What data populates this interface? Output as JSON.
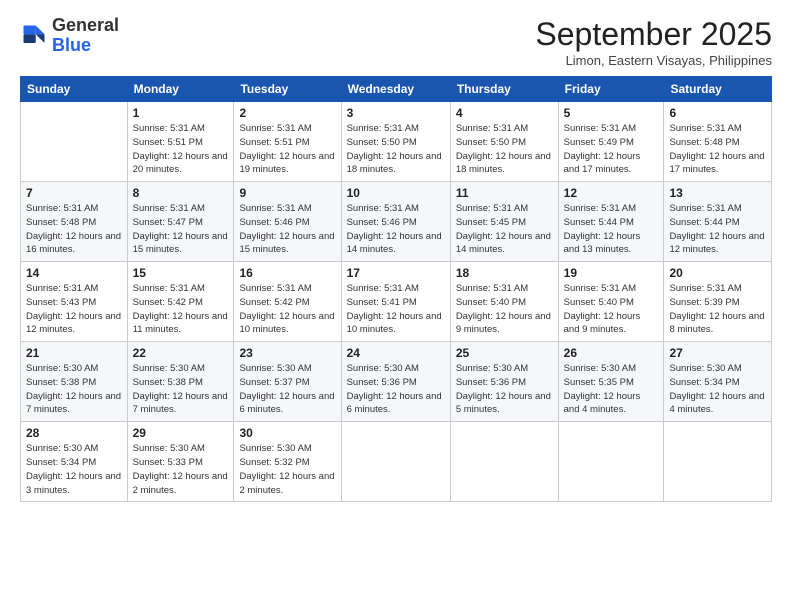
{
  "header": {
    "logo_general": "General",
    "logo_blue": "Blue",
    "cal_title": "September 2025",
    "cal_subtitle": "Limon, Eastern Visayas, Philippines"
  },
  "weekdays": [
    "Sunday",
    "Monday",
    "Tuesday",
    "Wednesday",
    "Thursday",
    "Friday",
    "Saturday"
  ],
  "weeks": [
    [
      {
        "day": "",
        "info": ""
      },
      {
        "day": "1",
        "info": "Sunrise: 5:31 AM\nSunset: 5:51 PM\nDaylight: 12 hours\nand 20 minutes."
      },
      {
        "day": "2",
        "info": "Sunrise: 5:31 AM\nSunset: 5:51 PM\nDaylight: 12 hours\nand 19 minutes."
      },
      {
        "day": "3",
        "info": "Sunrise: 5:31 AM\nSunset: 5:50 PM\nDaylight: 12 hours\nand 18 minutes."
      },
      {
        "day": "4",
        "info": "Sunrise: 5:31 AM\nSunset: 5:50 PM\nDaylight: 12 hours\nand 18 minutes."
      },
      {
        "day": "5",
        "info": "Sunrise: 5:31 AM\nSunset: 5:49 PM\nDaylight: 12 hours\nand 17 minutes."
      },
      {
        "day": "6",
        "info": "Sunrise: 5:31 AM\nSunset: 5:48 PM\nDaylight: 12 hours\nand 17 minutes."
      }
    ],
    [
      {
        "day": "7",
        "info": "Sunrise: 5:31 AM\nSunset: 5:48 PM\nDaylight: 12 hours\nand 16 minutes."
      },
      {
        "day": "8",
        "info": "Sunrise: 5:31 AM\nSunset: 5:47 PM\nDaylight: 12 hours\nand 15 minutes."
      },
      {
        "day": "9",
        "info": "Sunrise: 5:31 AM\nSunset: 5:46 PM\nDaylight: 12 hours\nand 15 minutes."
      },
      {
        "day": "10",
        "info": "Sunrise: 5:31 AM\nSunset: 5:46 PM\nDaylight: 12 hours\nand 14 minutes."
      },
      {
        "day": "11",
        "info": "Sunrise: 5:31 AM\nSunset: 5:45 PM\nDaylight: 12 hours\nand 14 minutes."
      },
      {
        "day": "12",
        "info": "Sunrise: 5:31 AM\nSunset: 5:44 PM\nDaylight: 12 hours\nand 13 minutes."
      },
      {
        "day": "13",
        "info": "Sunrise: 5:31 AM\nSunset: 5:44 PM\nDaylight: 12 hours\nand 12 minutes."
      }
    ],
    [
      {
        "day": "14",
        "info": "Sunrise: 5:31 AM\nSunset: 5:43 PM\nDaylight: 12 hours\nand 12 minutes."
      },
      {
        "day": "15",
        "info": "Sunrise: 5:31 AM\nSunset: 5:42 PM\nDaylight: 12 hours\nand 11 minutes."
      },
      {
        "day": "16",
        "info": "Sunrise: 5:31 AM\nSunset: 5:42 PM\nDaylight: 12 hours\nand 10 minutes."
      },
      {
        "day": "17",
        "info": "Sunrise: 5:31 AM\nSunset: 5:41 PM\nDaylight: 12 hours\nand 10 minutes."
      },
      {
        "day": "18",
        "info": "Sunrise: 5:31 AM\nSunset: 5:40 PM\nDaylight: 12 hours\nand 9 minutes."
      },
      {
        "day": "19",
        "info": "Sunrise: 5:31 AM\nSunset: 5:40 PM\nDaylight: 12 hours\nand 9 minutes."
      },
      {
        "day": "20",
        "info": "Sunrise: 5:31 AM\nSunset: 5:39 PM\nDaylight: 12 hours\nand 8 minutes."
      }
    ],
    [
      {
        "day": "21",
        "info": "Sunrise: 5:30 AM\nSunset: 5:38 PM\nDaylight: 12 hours\nand 7 minutes."
      },
      {
        "day": "22",
        "info": "Sunrise: 5:30 AM\nSunset: 5:38 PM\nDaylight: 12 hours\nand 7 minutes."
      },
      {
        "day": "23",
        "info": "Sunrise: 5:30 AM\nSunset: 5:37 PM\nDaylight: 12 hours\nand 6 minutes."
      },
      {
        "day": "24",
        "info": "Sunrise: 5:30 AM\nSunset: 5:36 PM\nDaylight: 12 hours\nand 6 minutes."
      },
      {
        "day": "25",
        "info": "Sunrise: 5:30 AM\nSunset: 5:36 PM\nDaylight: 12 hours\nand 5 minutes."
      },
      {
        "day": "26",
        "info": "Sunrise: 5:30 AM\nSunset: 5:35 PM\nDaylight: 12 hours\nand 4 minutes."
      },
      {
        "day": "27",
        "info": "Sunrise: 5:30 AM\nSunset: 5:34 PM\nDaylight: 12 hours\nand 4 minutes."
      }
    ],
    [
      {
        "day": "28",
        "info": "Sunrise: 5:30 AM\nSunset: 5:34 PM\nDaylight: 12 hours\nand 3 minutes."
      },
      {
        "day": "29",
        "info": "Sunrise: 5:30 AM\nSunset: 5:33 PM\nDaylight: 12 hours\nand 2 minutes."
      },
      {
        "day": "30",
        "info": "Sunrise: 5:30 AM\nSunset: 5:32 PM\nDaylight: 12 hours\nand 2 minutes."
      },
      {
        "day": "",
        "info": ""
      },
      {
        "day": "",
        "info": ""
      },
      {
        "day": "",
        "info": ""
      },
      {
        "day": "",
        "info": ""
      }
    ]
  ]
}
